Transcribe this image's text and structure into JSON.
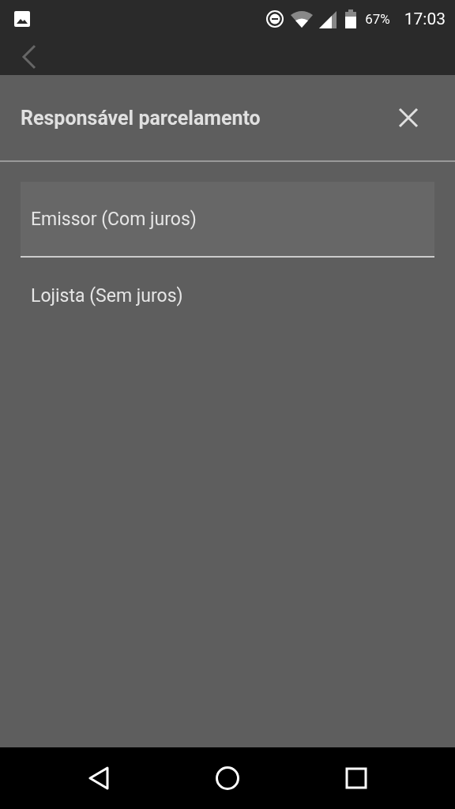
{
  "status_bar": {
    "battery": "67%",
    "time": "17:03"
  },
  "dialog": {
    "title": "Responsável parcelamento",
    "options": [
      {
        "label": "Emissor (Com juros)",
        "selected": true
      },
      {
        "label": "Lojista (Sem juros)",
        "selected": false
      }
    ]
  }
}
